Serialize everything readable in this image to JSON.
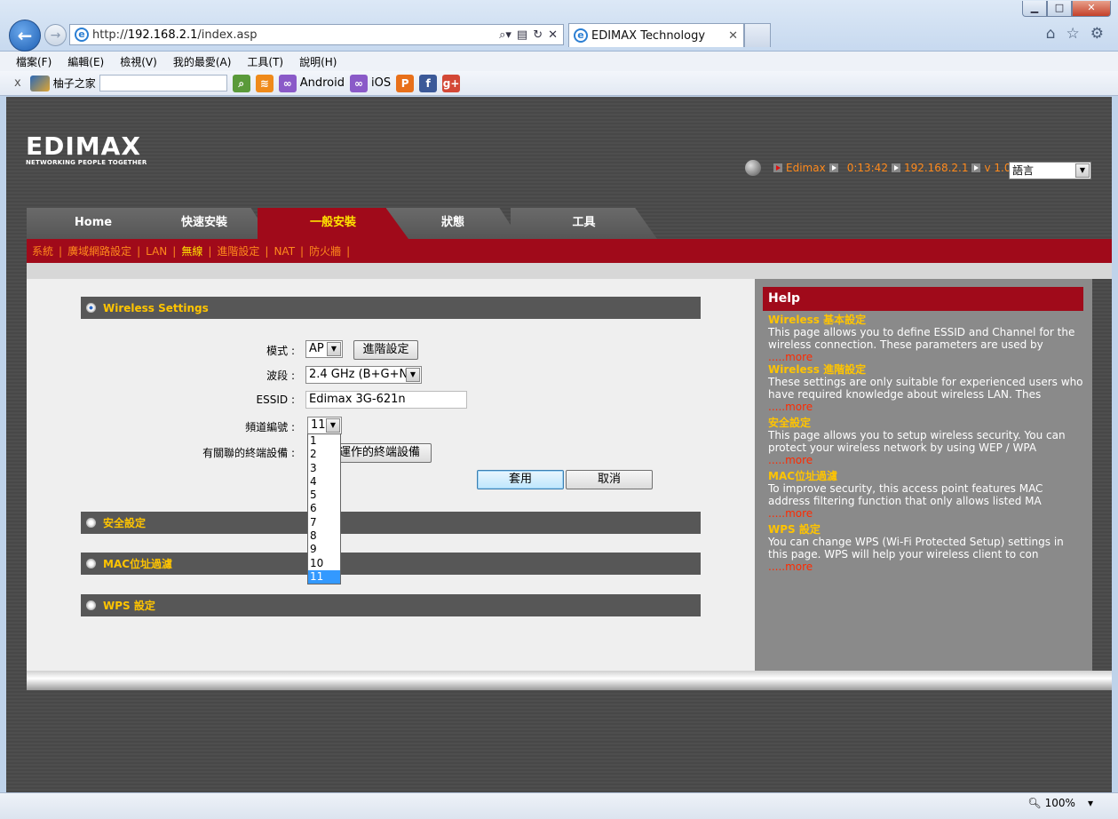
{
  "browser": {
    "url_prefix": "http://",
    "url_host": "192.168.2.1",
    "url_path": "/index.asp",
    "tab_title": "EDIMAX Technology",
    "menu": [
      "檔案(F)",
      "編輯(E)",
      "檢視(V)",
      "我的最愛(A)",
      "工具(T)",
      "說明(H)"
    ],
    "toolbar": {
      "close": "x",
      "site_name": "柚子之家",
      "android_label": "Android",
      "ios_label": "iOS"
    },
    "zoom": "100%"
  },
  "header": {
    "logo": "EDIMAX",
    "tagline": "NETWORKING PEOPLE TOGETHER",
    "user": "Edimax",
    "time": "0:13:42",
    "ip": "192.168.2.1",
    "version": "v 1.06e",
    "language": "語言"
  },
  "main_tabs": [
    "Home",
    "快速安裝",
    "一般安裝",
    "狀態",
    "工具"
  ],
  "active_tab": "一般安裝",
  "sub_nav": [
    "系統",
    "廣域網路設定",
    "LAN",
    "無線",
    "進階設定",
    "NAT",
    "防火牆"
  ],
  "sub_nav_current": "無線",
  "wireless": {
    "section_title": "Wireless Settings",
    "mode_label": "模式 :",
    "mode_value": "AP",
    "advanced_button": "進階設定",
    "band_label": "波段 :",
    "band_value": "2.4 GHz (B+G+N)",
    "essid_label": "ESSID :",
    "essid_value": "Edimax 3G-621n",
    "channel_label": "頻道編號 :",
    "channel_value": "11",
    "channel_options": [
      "1",
      "2",
      "3",
      "4",
      "5",
      "6",
      "7",
      "8",
      "9",
      "10",
      "11"
    ],
    "clients_label": "有關聯的終端設備 :",
    "clients_button": "顯示運作的終端設備",
    "apply": "套用",
    "cancel": "取消"
  },
  "sections": [
    "安全設定",
    "MAC位址過濾",
    "WPS 設定"
  ],
  "help": {
    "title": "Help",
    "more": ".....more",
    "items": [
      {
        "title": "Wireless 基本設定",
        "text": "This page allows you to define ESSID and Channel for the wireless connection. These parameters are used by"
      },
      {
        "title": "Wireless 進階設定",
        "text": "These settings are only suitable for experienced users who have required knowledge about wireless LAN. Thes"
      },
      {
        "title": "安全設定",
        "text": "This page allows you to setup wireless security. You can protect your wireless network by using WEP / WPA"
      },
      {
        "title": "MAC位址過濾",
        "text": "To improve security, this access point features MAC address filtering function that only allows listed MA"
      },
      {
        "title": "WPS 設定",
        "text": "You can change WPS (Wi-Fi Protected Setup) settings in this page. WPS will help your wireless client to con"
      }
    ]
  },
  "colors": {
    "brand_red": "#a00a1a",
    "accent_yellow": "#ffc400",
    "link_orange": "#ff8a1c"
  }
}
